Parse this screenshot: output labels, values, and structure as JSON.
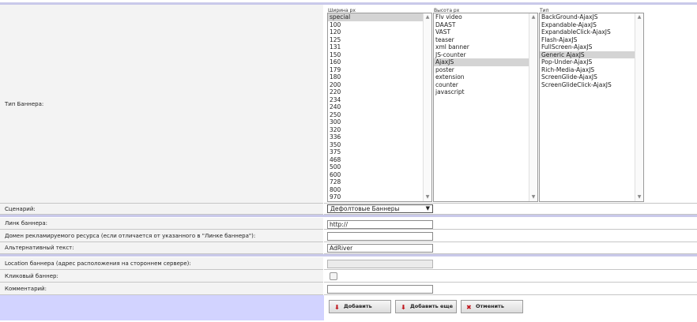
{
  "banner_type": {
    "label": "Тип Баннера:",
    "width_label": "Ширина px",
    "height_label": "Высота px",
    "type_label": "Тип",
    "widths": [
      "special",
      "100",
      "120",
      "125",
      "131",
      "150",
      "160",
      "179",
      "180",
      "200",
      "220",
      "234",
      "240",
      "250",
      "300",
      "320",
      "336",
      "350",
      "375",
      "468",
      "500",
      "600",
      "728",
      "800",
      "970"
    ],
    "widths_selected": "special",
    "heights": [
      "Flv video",
      "DAAST",
      "VAST",
      "teaser",
      "xml banner",
      "JS-counter",
      "AjaxJS",
      "poster",
      "extension",
      "counter",
      "javascript"
    ],
    "heights_selected": "AjaxJS",
    "types": [
      "BackGround-AjaxJS",
      "Expandable-AjaxJS",
      "ExpandableClick-AjaxJS",
      "Flash-AjaxJS",
      "FullScreen-AjaxJS",
      "Generic AjaxJS",
      "Pop-Under-AjaxJS",
      "Rich-Media-AjaxJS",
      "ScreenGlide-AjaxJS",
      "ScreenGlideClick-AjaxJS"
    ],
    "types_selected": "Generic AjaxJS"
  },
  "scenario": {
    "label": "Сценарий:",
    "value": "Дефолтовые Баннеры"
  },
  "link": {
    "label": "Линк баннера:",
    "value": "http://"
  },
  "domain": {
    "label": "Домен рекламируемого ресурса (если отличается от указанного в \"Линке баннера\"):",
    "value": ""
  },
  "alt_text": {
    "label": "Альтернативный текст:",
    "value": "AdRiver"
  },
  "location": {
    "label": "Location баннера (адрес расположения на стороннем сервере):",
    "value": ""
  },
  "clickable": {
    "label": "Кликовый баннер:",
    "checked": false
  },
  "comment": {
    "label": "Комментарий:",
    "value": ""
  },
  "buttons": {
    "add": "Добавить",
    "add_more": "Добавить еще",
    "cancel": "Отменить"
  },
  "colors": {
    "rule": "#c9c9ea",
    "label_bg": "#f3f3f3",
    "button_bar": "#d2d3ff",
    "selection": "#d4d4d4"
  }
}
